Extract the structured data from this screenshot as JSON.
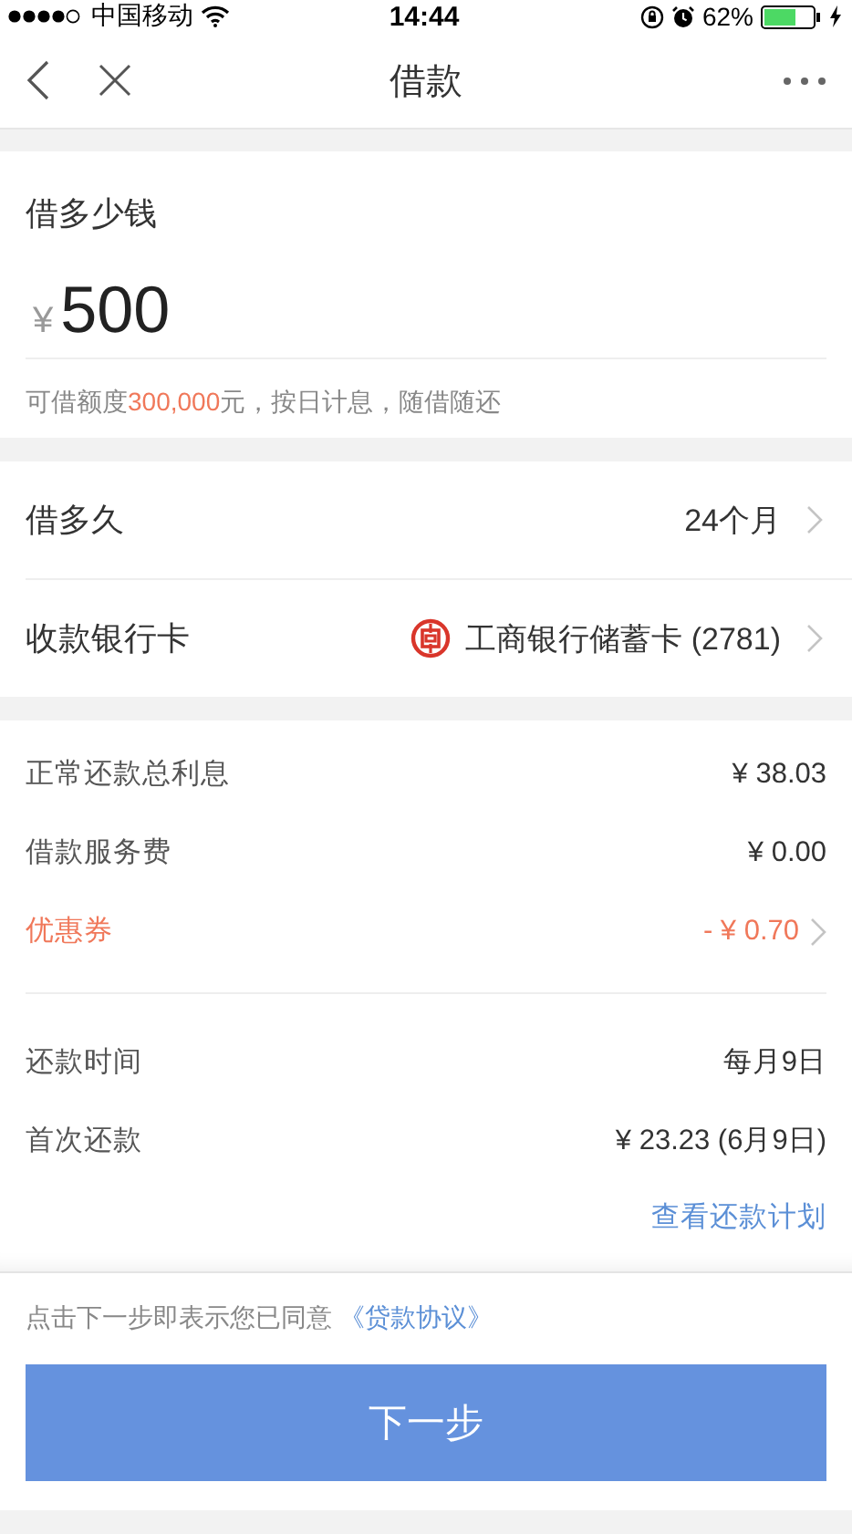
{
  "status_bar": {
    "carrier": "中国移动",
    "time": "14:44",
    "battery": "62%"
  },
  "nav": {
    "title": "借款"
  },
  "amount": {
    "label": "借多少钱",
    "currency": "¥",
    "value": "500",
    "note": [
      {
        "text": "可借额度",
        "highlight": false
      },
      {
        "text": "300,000",
        "highlight": true
      },
      {
        "text": "元，按日计息，随借随还",
        "highlight": false
      }
    ]
  },
  "options": [
    {
      "label": "借多久",
      "value": "24个月",
      "kind": "plain"
    },
    {
      "label": "收款银行卡",
      "value": "工商银行储蓄卡 (2781)",
      "kind": "bank"
    }
  ],
  "fees": [
    {
      "label": "正常还款总利息",
      "value": "¥ 38.03",
      "kind": "plain"
    },
    {
      "label": "借款服务费",
      "value": "¥ 0.00",
      "kind": "plain"
    },
    {
      "label": "优惠券",
      "value": "- ¥ 0.70",
      "kind": "coupon"
    }
  ],
  "schedule": [
    {
      "label": "还款时间",
      "value": "每月9日"
    },
    {
      "label": "首次还款",
      "value": "¥ 23.23 (6月9日)"
    }
  ],
  "schedule_link": "查看还款计划",
  "agreement": {
    "text": "点击下一步即表示您已同意",
    "link": "《贷款协议》"
  },
  "next_button": "下一步"
}
